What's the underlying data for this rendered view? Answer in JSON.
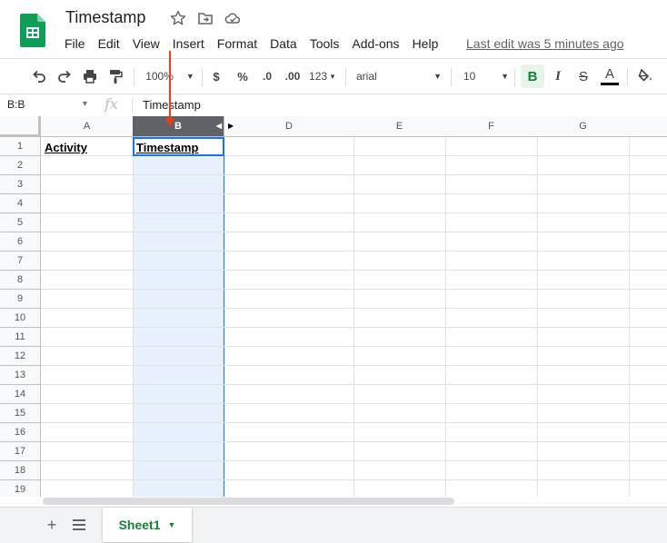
{
  "app": {
    "title": "Timestamp",
    "last_edit": "Last edit was 5 minutes ago",
    "brand_color": "#0f9d58"
  },
  "menu": [
    "File",
    "Edit",
    "View",
    "Insert",
    "Format",
    "Data",
    "Tools",
    "Add-ons",
    "Help"
  ],
  "toolbar": {
    "zoom": "100%",
    "currency": "$",
    "percent": "%",
    "decrease_decimals": ".0",
    "increase_decimals": ".00",
    "more_formats": "123",
    "font": "arial",
    "font_size": "10",
    "bold": "B",
    "italic": "I",
    "strikethrough": "S",
    "text_color_label": "A",
    "text_color": "#000000"
  },
  "formula_bar": {
    "name_box": "B:B",
    "fx": "fx",
    "value": "Timestamp"
  },
  "grid": {
    "columns": [
      "A",
      "B",
      "D",
      "E",
      "F",
      "G"
    ],
    "selected_column": "B",
    "rows": [
      "1",
      "2",
      "3",
      "4",
      "5",
      "6",
      "7",
      "8",
      "9",
      "10",
      "11",
      "12",
      "13",
      "14",
      "15",
      "16",
      "17",
      "18",
      "19"
    ],
    "cells": {
      "A1": "Activity",
      "B1": "Timestamp"
    },
    "selection_color": "#1a73e8"
  },
  "sheets": {
    "tabs": [
      "Sheet1"
    ],
    "active": "Sheet1"
  },
  "annotation_color": "#e8401c"
}
